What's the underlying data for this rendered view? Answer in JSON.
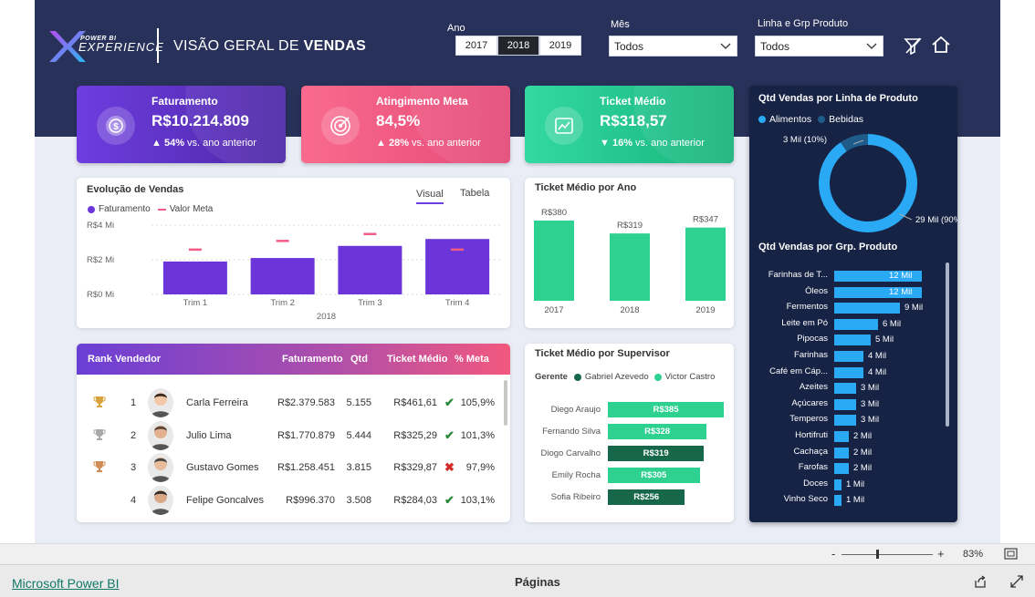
{
  "header": {
    "logo_top": "POWER BI",
    "logo_main": "EXPERIENCE",
    "title_prefix": "VISÃO GERAL DE",
    "title_bold": "VENDAS"
  },
  "filters": {
    "ano_label": "Ano",
    "years": [
      "2017",
      "2018",
      "2019"
    ],
    "selected_year": "2018",
    "mes_label": "Mês",
    "mes_value": "Todos",
    "linha_label": "Linha e Grp Produto",
    "linha_value": "Todos"
  },
  "kpis": {
    "faturamento": {
      "title": "Faturamento",
      "value": "R$10.214.809",
      "delta_arrow": "▲",
      "delta_pct": "54%",
      "delta_text": "vs. ano anterior",
      "icon": "dollar-coin-icon"
    },
    "meta": {
      "title": "Atingimento Meta",
      "value": "84,5%",
      "delta_arrow": "▲",
      "delta_pct": "28%",
      "delta_text": "vs. ano anterior",
      "icon": "target-icon"
    },
    "ticket": {
      "title": "Ticket Médio",
      "value": "R$318,57",
      "delta_arrow": "▼",
      "delta_pct": "16%",
      "delta_text": "vs. ano anterior",
      "icon": "trend-chart-icon"
    }
  },
  "evolucao": {
    "title": "Evolução de Vendas",
    "tabs": [
      "Visual",
      "Tabela"
    ],
    "legend": [
      "Faturamento",
      "Valor Meta"
    ],
    "yticks": [
      "R$4 Mi",
      "R$2 Mi",
      "R$0 Mi"
    ],
    "year_label": "2018"
  },
  "ticket_ano": {
    "title": "Ticket Médio por Ano"
  },
  "rank": {
    "headers": [
      "Rank Vendedor",
      "Faturamento",
      "Qtd",
      "Ticket Médio",
      "% Meta"
    ],
    "rows": [
      {
        "rank": "1",
        "name": "Carla Ferreira",
        "fat": "R$2.379.583",
        "qtd": "5.155",
        "ticket": "R$461,61",
        "status": "✔",
        "meta": "105,9%",
        "trophy": "gold"
      },
      {
        "rank": "2",
        "name": "Julio Lima",
        "fat": "R$1.770.879",
        "qtd": "5.444",
        "ticket": "R$325,29",
        "status": "✔",
        "meta": "101,3%",
        "trophy": "silver"
      },
      {
        "rank": "3",
        "name": "Gustavo Gomes",
        "fat": "R$1.258.451",
        "qtd": "3.815",
        "ticket": "R$329,87",
        "status": "✖",
        "meta": "97,9%",
        "trophy": "bronze"
      },
      {
        "rank": "4",
        "name": "Felipe Goncalves",
        "fat": "R$996.370",
        "qtd": "3.508",
        "ticket": "R$284,03",
        "status": "✔",
        "meta": "103,1%",
        "trophy": ""
      }
    ]
  },
  "supervisor": {
    "title": "Ticket Médio por Supervisor",
    "legend_title": "Gerente",
    "legend": [
      "Gabriel Azevedo",
      "Victor Castro"
    ]
  },
  "dark_panel": {
    "linha_title": "Qtd Vendas por Linha de Produto",
    "linha_legend": [
      "Alimentos",
      "Bebidas"
    ],
    "grp_title": "Qtd Vendas por Grp. Produto"
  },
  "zoom": {
    "minus": "-",
    "plus": "+",
    "value": "83%"
  },
  "footer": {
    "link": "Microsoft Power BI",
    "pages": "Páginas"
  },
  "colors": {
    "purple": "#6b35d9",
    "pink": "#f25c86",
    "green": "#2ed190",
    "darkgreen": "#17684a",
    "blue": "#2aaaf5",
    "navy": "#283159"
  },
  "chart_data": [
    {
      "type": "bar",
      "title": "Evolução de Vendas",
      "categories": [
        "Trim 1",
        "Trim 2",
        "Trim 3",
        "Trim 4"
      ],
      "xlabel": "2018",
      "ylim": [
        0,
        4
      ],
      "series": [
        {
          "name": "Faturamento",
          "values": [
            1.9,
            2.1,
            2.8,
            3.2
          ]
        },
        {
          "name": "Valor Meta",
          "values": [
            2.6,
            3.1,
            3.5,
            2.6
          ]
        }
      ]
    },
    {
      "type": "bar",
      "title": "Ticket Médio por Ano",
      "categories": [
        "2017",
        "2018",
        "2019"
      ],
      "values": [
        380,
        319,
        347
      ],
      "labels": [
        "R$380",
        "R$319",
        "R$347"
      ]
    },
    {
      "type": "bar",
      "title": "Ticket Médio por Supervisor",
      "categories": [
        "Diego Araujo",
        "Fernando Silva",
        "Diogo Carvalho",
        "Emily Rocha",
        "Sofia Ribeiro"
      ],
      "values": [
        385,
        328,
        319,
        305,
        256
      ],
      "labels": [
        "R$385",
        "R$328",
        "R$319",
        "R$305",
        "R$256"
      ],
      "gerente": [
        "Victor Castro",
        "Victor Castro",
        "Gabriel Azevedo",
        "Victor Castro",
        "Gabriel Azevedo"
      ]
    },
    {
      "type": "pie",
      "title": "Qtd Vendas por Linha de Produto",
      "categories": [
        "Alimentos",
        "Bebidas"
      ],
      "values": [
        29,
        3
      ],
      "labels": [
        "29 Mil (90%)",
        "3 Mil (10%)"
      ]
    },
    {
      "type": "bar",
      "title": "Qtd Vendas por Grp. Produto",
      "categories": [
        "Farinhas de T...",
        "Óleos",
        "Fermentos",
        "Leite em Pó",
        "Pipocas",
        "Farinhas",
        "Café em Cáp...",
        "Azeites",
        "Açúcares",
        "Temperos",
        "Hortifruti",
        "Cachaça",
        "Farofas",
        "Doces",
        "Vinho Seco"
      ],
      "values": [
        12,
        12,
        9,
        6,
        5,
        4,
        4,
        3,
        3,
        3,
        2,
        2,
        2,
        1,
        1
      ],
      "labels": [
        "12 Mil",
        "12 Mil",
        "9 Mil",
        "6 Mil",
        "5 Mil",
        "4 Mil",
        "4 Mil",
        "3 Mil",
        "3 Mil",
        "3 Mil",
        "2 Mil",
        "2 Mil",
        "2 Mil",
        "1 Mil",
        "1 Mil"
      ]
    }
  ]
}
